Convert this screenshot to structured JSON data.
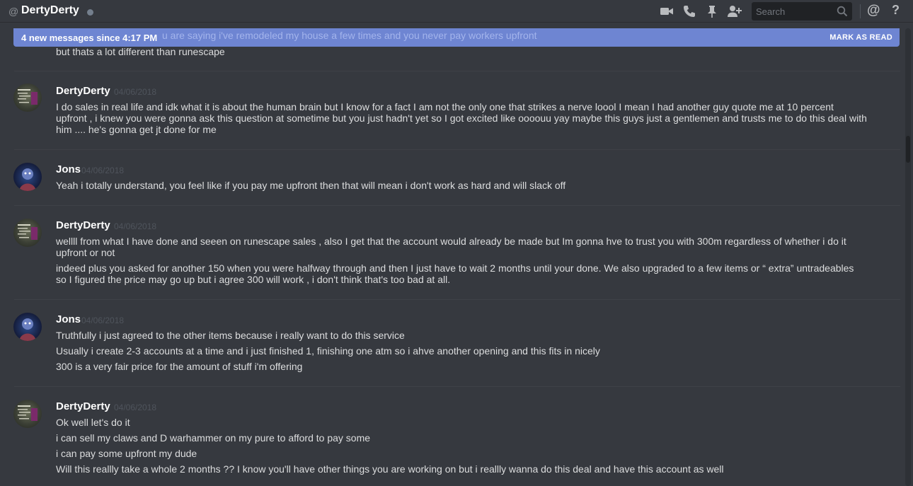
{
  "header": {
    "at_symbol": "@",
    "channel_name": "DertyDerty",
    "search_placeholder": "Search",
    "icons": [
      "video-call-icon",
      "voice-call-icon",
      "pin-icon",
      "add-friend-icon",
      "search-icon",
      "mentions-icon",
      "help-icon"
    ],
    "help_label": "?",
    "mentions_label": "@"
  },
  "banner": {
    "text": "4 new messages since 4:17 PM",
    "behind_text": "u are saying i've remodeled my house a few times and you never pay workers upfront",
    "mark_read": "MARK AS READ"
  },
  "top_fragment": "but thats a lot different than runescape",
  "messages": [
    {
      "author": "DertyDerty",
      "timestamp": "04/06/2018",
      "lines": [
        "I do sales in real life and idk what it is about the human brain but I know for a fact I am not the only one that strikes a nerve loool I mean I had another guy quote me at 10 percent\nupfront , i knew you were gonna ask this question at sometime but you just hadn't yet so I got excited like oooouu yay maybe this guys just a gentlemen and trusts me to do this deal with\nhim .... he's gonna get jt done for me"
      ]
    },
    {
      "author": "Jons",
      "timestamp": "04/06/2018",
      "lines": [
        "Yeah i totally understand, you feel like if you pay me upfront then that will mean i don't work as hard and will slack off"
      ]
    },
    {
      "author": "DertyDerty",
      "timestamp": "04/06/2018",
      "lines": [
        "wellll from what I have done and seeen on runescape sales , also I get that the account would already be made but Im gonna hve to trust you with 300m regardless of whether i do it\nupfront or not",
        "indeed plus you asked for another 150 when you were halfway through and then I just have to wait 2 months until your done. We also upgraded to a few items or “ extra” untradeables\nso I figured the price may go up but i agree 300 will work , i don't think that's too bad at all."
      ]
    },
    {
      "author": "Jons",
      "timestamp": "04/06/2018",
      "lines": [
        "Truthfully i just agreed to the other items because i really want to do this service",
        "Usually i create 2-3 accounts at a time and i just finished 1, finishing one atm so i ahve another opening and this fits in nicely",
        "300 is a very fair price for the amount of stuff i'm offering"
      ]
    },
    {
      "author": "DertyDerty",
      "timestamp": "04/06/2018",
      "lines": [
        "Ok well let's do it",
        "i can sell my claws and D warhammer on my pure to afford to pay some",
        "i can pay some upfront my dude",
        "Will this reallly take a whole 2 months ?? I know you'll have other things you are working on but i reallly wanna do this deal and have this account as well"
      ]
    }
  ],
  "colors": {
    "background": "#36393f",
    "banner": "#7289da",
    "timestamp": "#4f545c",
    "text": "#dcddde"
  }
}
